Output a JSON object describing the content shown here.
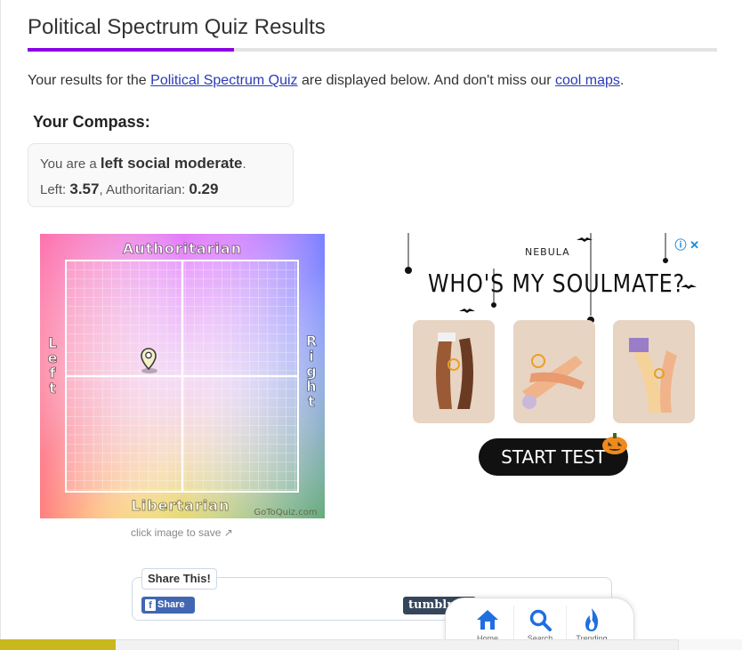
{
  "page": {
    "title": "Political Spectrum Quiz Results",
    "colors": {
      "accent": "#8c00e6",
      "link": "#2a3bb8"
    }
  },
  "intro": {
    "text_before": "Your results for the ",
    "quiz_link": "Political Spectrum Quiz",
    "text_middle": " are displayed below. And don't miss our ",
    "maps_link": "cool maps",
    "text_after": "."
  },
  "compass": {
    "heading": "Your Compass:",
    "line1_prefix": "You are a ",
    "result_label": "left social moderate",
    "line1_suffix": ".",
    "left_label": "Left: ",
    "left_value": "3.57",
    "auth_label": ", Authoritarian: ",
    "auth_value": "0.29",
    "image": {
      "top_label": "Authoritarian",
      "bottom_label": "Libertarian",
      "left_label": "Left",
      "right_label": "Right",
      "watermark": "GoToQuiz.com"
    },
    "caption": "click image to save ↗"
  },
  "ad": {
    "brand": "NEBULA",
    "headline": "WHO'S MY SOULMATE?",
    "cta": "START TEST",
    "close_icon": "info-close-icon"
  },
  "share": {
    "legend": "Share This!",
    "facebook_label": "Share",
    "tumblr_label": "tumblr"
  },
  "bottom_nav": {
    "items": [
      {
        "icon": "home-icon",
        "label": "Home"
      },
      {
        "icon": "search-icon",
        "label": "Search"
      },
      {
        "icon": "trending-icon",
        "label": "Trending"
      }
    ]
  }
}
